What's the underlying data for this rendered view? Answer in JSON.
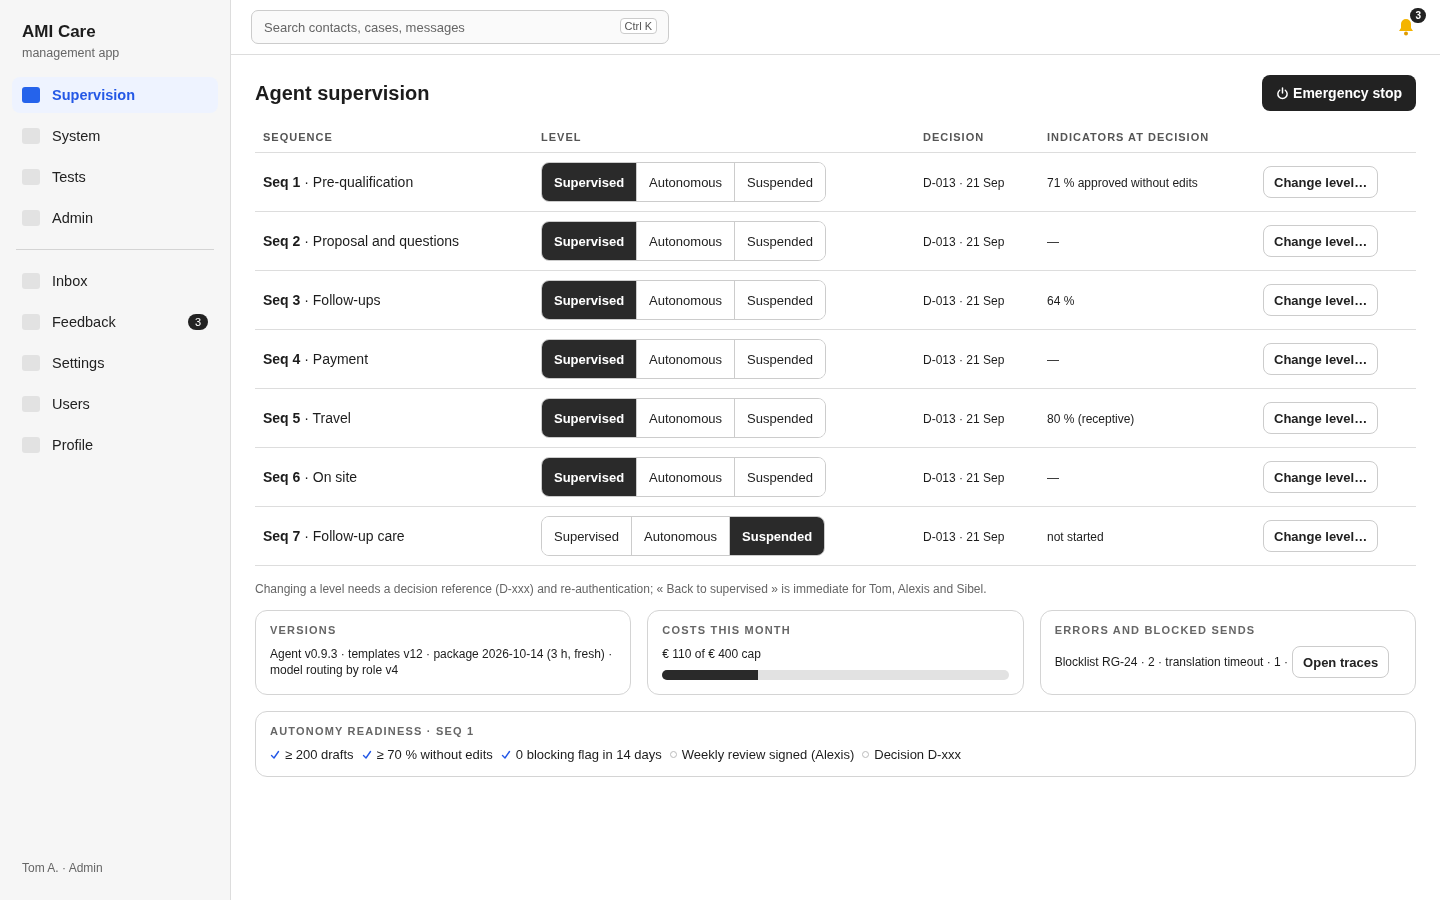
{
  "sidebar": {
    "title": "AMI Care",
    "subtitle": "management app",
    "groups": [
      [
        {
          "label": "Supervision",
          "selected": true
        },
        {
          "label": "System",
          "selected": false
        },
        {
          "label": "Tests",
          "selected": false
        },
        {
          "label": "Admin",
          "selected": false
        }
      ],
      [
        {
          "label": "Inbox",
          "selected": false
        },
        {
          "label": "Feedback",
          "selected": false,
          "badge": "3"
        },
        {
          "label": "Settings",
          "selected": false
        },
        {
          "label": "Users",
          "selected": false
        },
        {
          "label": "Profile",
          "selected": false
        }
      ]
    ],
    "footer": "Tom A. · Admin"
  },
  "topbar": {
    "search": {
      "placeholder": "Search contacts, cases, messages",
      "shortcut": "Ctrl K"
    },
    "notifications": {
      "count": "3"
    }
  },
  "page": {
    "title": "Agent supervision",
    "emergency_button": "Emergency stop"
  },
  "table": {
    "columns": [
      "SEQUENCE",
      "LEVEL",
      "DECISION",
      "INDICATORS AT DECISION"
    ],
    "rows": [
      {
        "sequence": "**Seq 1** · Pre-qualification",
        "levels": [
          {
            "label": "Supervised",
            "selected": true
          },
          {
            "label": "Autonomous",
            "selected": false
          },
          {
            "label": "Suspended",
            "selected": false
          }
        ],
        "decision": "D-013 · 21 Sep",
        "indicator": "71 % approved without edits",
        "action": "Change level…"
      },
      {
        "sequence": "**Seq 2** · Proposal and questions",
        "levels": [
          {
            "label": "Supervised",
            "selected": true
          },
          {
            "label": "Autonomous",
            "selected": false
          },
          {
            "label": "Suspended",
            "selected": false
          }
        ],
        "decision": "D-013 · 21 Sep",
        "indicator": "—",
        "action": "Change level…"
      },
      {
        "sequence": "**Seq 3** · Follow-ups",
        "levels": [
          {
            "label": "Supervised",
            "selected": true
          },
          {
            "label": "Autonomous",
            "selected": false
          },
          {
            "label": "Suspended",
            "selected": false
          }
        ],
        "decision": "D-013 · 21 Sep",
        "indicator": "64 %",
        "action": "Change level…"
      },
      {
        "sequence": "**Seq 4** · Payment",
        "levels": [
          {
            "label": "Supervised",
            "selected": true
          },
          {
            "label": "Autonomous",
            "selected": false
          },
          {
            "label": "Suspended",
            "selected": false
          }
        ],
        "decision": "D-013 · 21 Sep",
        "indicator": "—",
        "action": "Change level…"
      },
      {
        "sequence": "**Seq 5** · Travel",
        "levels": [
          {
            "label": "Supervised",
            "selected": true
          },
          {
            "label": "Autonomous",
            "selected": false
          },
          {
            "label": "Suspended",
            "selected": false
          }
        ],
        "decision": "D-013 · 21 Sep",
        "indicator": "80 % (receptive)",
        "action": "Change level…"
      },
      {
        "sequence": "**Seq 6** · On site",
        "levels": [
          {
            "label": "Supervised",
            "selected": true
          },
          {
            "label": "Autonomous",
            "selected": false
          },
          {
            "label": "Suspended",
            "selected": false
          }
        ],
        "decision": "D-013 · 21 Sep",
        "indicator": "—",
        "action": "Change level…"
      },
      {
        "sequence": "**Seq 7** · Follow-up care",
        "levels": [
          {
            "label": "Supervised",
            "selected": false
          },
          {
            "label": "Autonomous",
            "selected": false
          },
          {
            "label": "Suspended",
            "selected": true
          }
        ],
        "decision": "D-013 · 21 Sep",
        "indicator": "not started",
        "action": "Change level…"
      }
    ]
  },
  "note": "Changing a level needs a decision reference (D-xxx) and re-authentication; « Back to supervised » is immediate for Tom, Alexis and Sibel.",
  "cards": {
    "versions": {
      "title": "VERSIONS",
      "text": "Agent v0.9.3 · templates v12 · package 2026-10-14 (3 h, fresh) · model routing by role v4"
    },
    "costs": {
      "title": "COSTS THIS MONTH",
      "text": "€ 110 of € 400 cap",
      "level": 0.275
    },
    "errors": {
      "title": "ERRORS AND BLOCKED SENDS",
      "text": "Blocklist RG-24 · 2 · translation timeout · 1 ·",
      "button": "Open traces"
    }
  },
  "readiness": {
    "title": "AUTONOMY READINESS · SEQ 1",
    "items": [
      {
        "label": "≥ 200 drafts",
        "done": true
      },
      {
        "label": "≥ 70 % without edits",
        "done": true
      },
      {
        "label": "0 blocking flag in 14 days",
        "done": true
      },
      {
        "label": "Weekly review signed (Alexis)",
        "done": false
      },
      {
        "label": "Decision D-xxx",
        "done": false
      }
    ]
  }
}
